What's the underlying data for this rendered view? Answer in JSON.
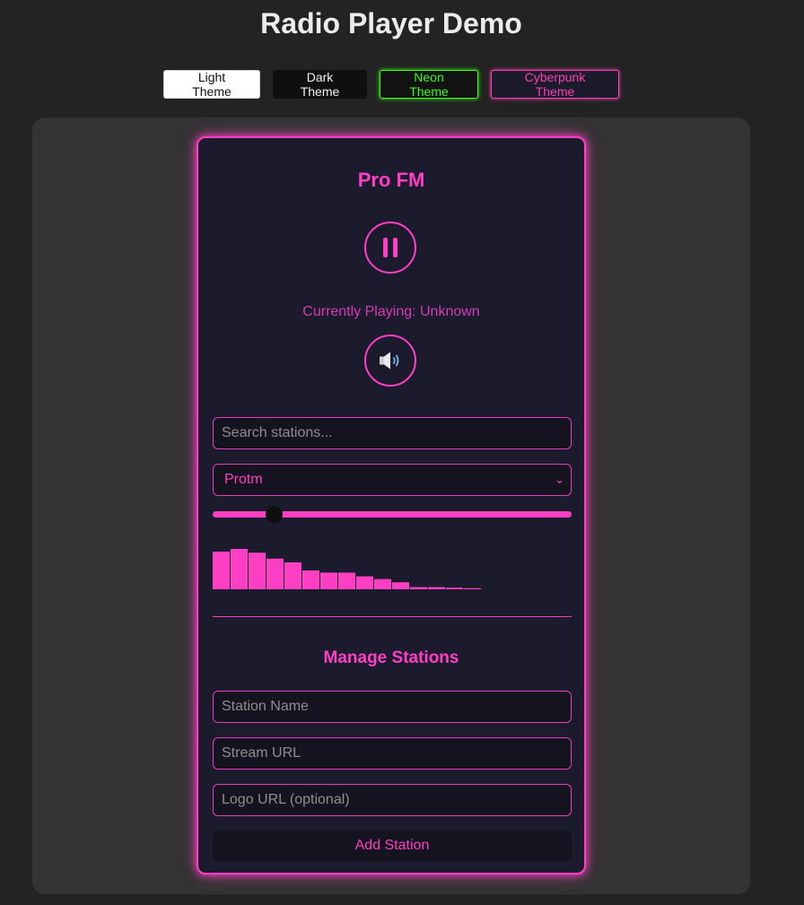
{
  "page": {
    "title": "Radio Player Demo"
  },
  "themes": {
    "light_label": "Light Theme",
    "dark_label": "Dark Theme",
    "neon_label": "Neon Theme",
    "cyberpunk_label": "Cyberpunk Theme",
    "active": "Cyberpunk Theme"
  },
  "player": {
    "station_name": "Pro FM",
    "playback_state": "playing",
    "pause_icon": "pause-icon",
    "volume_icon": "speaker-volume-icon",
    "now_playing": "Currently Playing: Unknown",
    "search_placeholder": "Search stations...",
    "selected_station": "Protm",
    "volume_level": 0.17,
    "visualizer_levels": [
      0.7,
      0.75,
      0.68,
      0.57,
      0.5,
      0.35,
      0.31,
      0.31,
      0.24,
      0.19,
      0.13,
      0.04,
      0.04,
      0.03,
      0.02
    ]
  },
  "manage": {
    "title": "Manage Stations",
    "name_placeholder": "Station Name",
    "url_placeholder": "Stream URL",
    "logo_placeholder": "Logo URL (optional)",
    "add_label": "Add Station"
  },
  "colors": {
    "accent": "#ff3fc3",
    "card_background": "#1c1b2e",
    "page_background": "#232323",
    "panel_background": "#333333",
    "neon_green": "#39ff14"
  }
}
